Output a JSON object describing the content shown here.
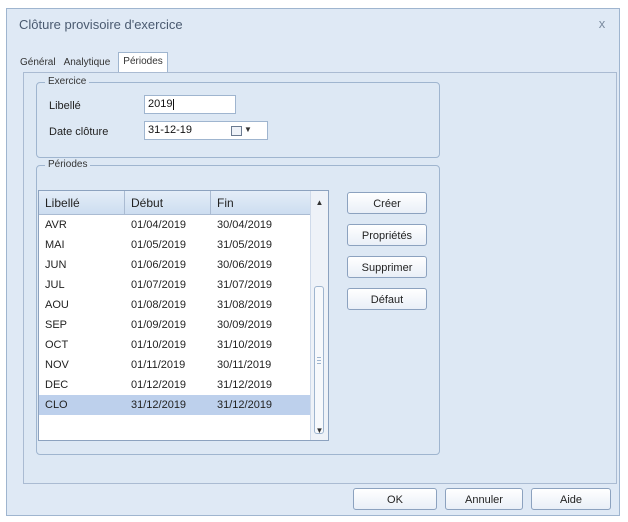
{
  "window": {
    "title": "Clôture provisoire d'exercice",
    "close_label": "x"
  },
  "tabs": [
    {
      "label": "Général"
    },
    {
      "label": "Analytique"
    },
    {
      "label": "Périodes"
    }
  ],
  "exercice": {
    "legend": "Exercice",
    "libelle_label": "Libellé",
    "libelle_value": "2019",
    "date_label": "Date clôture",
    "date_value": "31-12-19"
  },
  "periodes": {
    "legend": "Périodes",
    "columns": [
      "Libellé",
      "Début",
      "Fin"
    ],
    "rows": [
      [
        "AVR",
        "01/04/2019",
        "30/04/2019"
      ],
      [
        "MAI",
        "01/05/2019",
        "31/05/2019"
      ],
      [
        "JUN",
        "01/06/2019",
        "30/06/2019"
      ],
      [
        "JUL",
        "01/07/2019",
        "31/07/2019"
      ],
      [
        "AOU",
        "01/08/2019",
        "31/08/2019"
      ],
      [
        "SEP",
        "01/09/2019",
        "30/09/2019"
      ],
      [
        "OCT",
        "01/10/2019",
        "31/10/2019"
      ],
      [
        "NOV",
        "01/11/2019",
        "30/11/2019"
      ],
      [
        "DEC",
        "01/12/2019",
        "31/12/2019"
      ],
      [
        "CLO",
        "31/12/2019",
        "31/12/2019"
      ]
    ],
    "selected_row": 9,
    "buttons": {
      "creer": "Créer",
      "proprietes": "Propriétés",
      "supprimer": "Supprimer",
      "defaut": "Défaut"
    }
  },
  "footer": {
    "ok": "OK",
    "annuler": "Annuler",
    "aide": "Aide"
  },
  "icons": {
    "calendar": "calendar-icon",
    "dropdown": "chevron-down-icon",
    "scroll_up": "scroll-up-icon",
    "scroll_down": "scroll-down-icon"
  },
  "colors": {
    "window_bg": "#dfe9f5",
    "selected_row": "#bdd0ec",
    "border": "#9fb5cf"
  }
}
